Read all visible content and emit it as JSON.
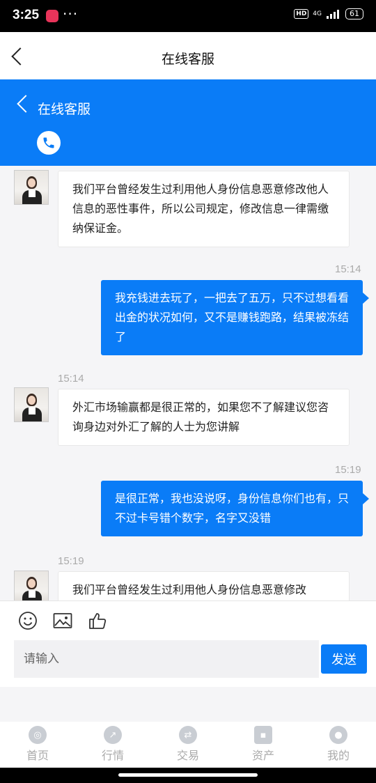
{
  "status_bar": {
    "time": "3:25",
    "dots": "···",
    "hd": "HD",
    "network": "4G",
    "battery": "61"
  },
  "header": {
    "title": "在线客服"
  },
  "service_header": {
    "title": "在线客服"
  },
  "messages": [
    {
      "from": "agent",
      "time": "",
      "text": "我们平台曾经发生过利用他人身份信息恶意修改他人信息的恶性事件，所以公司规定，修改信息一律需缴纳保证金。"
    },
    {
      "from": "user",
      "time": "15:14",
      "text": "我充钱进去玩了，一把去了五万，只不过想看看出金的状况如何，又不是赚钱跑路，结果被冻结了"
    },
    {
      "from": "agent",
      "time": "15:14",
      "text": "外汇市场输赢都是很正常的，如果您不了解建议您咨询身边对外汇了解的人士为您讲解"
    },
    {
      "from": "user",
      "time": "15:19",
      "text": "是很正常，我也没说呀，身份信息你们也有，只不过卡号错个数字，名字又没错"
    },
    {
      "from": "agent",
      "time": "15:19",
      "text": "我们平台曾经发生过利用他人身份信息恶意修改"
    }
  ],
  "composer": {
    "placeholder": "请输入",
    "send_label": "发送"
  },
  "tabs": [
    {
      "label": "首页",
      "icon": "home-icon"
    },
    {
      "label": "行情",
      "icon": "market-icon"
    },
    {
      "label": "交易",
      "icon": "trade-icon"
    },
    {
      "label": "资产",
      "icon": "wallet-icon"
    },
    {
      "label": "我的",
      "icon": "profile-icon"
    }
  ]
}
